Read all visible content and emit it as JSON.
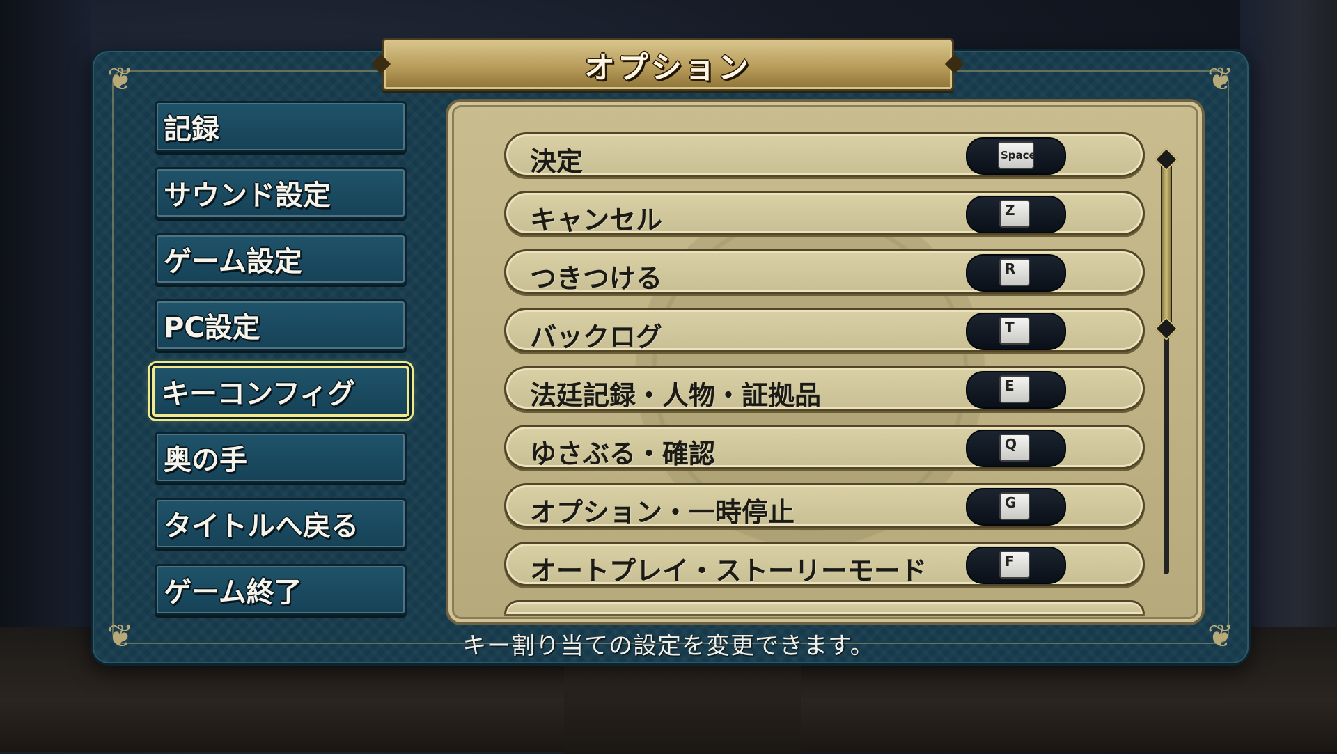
{
  "title": "オプション",
  "menu": {
    "items": [
      {
        "label": "記録"
      },
      {
        "label": "サウンド設定"
      },
      {
        "label": "ゲーム設定"
      },
      {
        "label": "PC設定"
      },
      {
        "label": "キーコンフィグ",
        "selected": true
      },
      {
        "label": "奥の手"
      },
      {
        "label": "タイトルへ戻る"
      },
      {
        "label": "ゲーム終了"
      }
    ]
  },
  "key_config": {
    "rows": [
      {
        "action": "決定",
        "key": "Space"
      },
      {
        "action": "キャンセル",
        "key": "Z"
      },
      {
        "action": "つきつける",
        "key": "R"
      },
      {
        "action": "バックログ",
        "key": "T"
      },
      {
        "action": "法廷記録・人物・証拠品",
        "key": "E"
      },
      {
        "action": "ゆさぶる・確認",
        "key": "Q"
      },
      {
        "action": "オプション・一時停止",
        "key": "G"
      },
      {
        "action": "オートプレイ・ストーリーモード",
        "key": "F"
      }
    ]
  },
  "description": "キー割り当ての設定を変更できます。",
  "colors": {
    "panel": "#163a4b",
    "menu_button": "#1f536a",
    "selected_outline": "#f2ea8a",
    "board": "#c9bd8f",
    "title_banner": "#b89c5a"
  }
}
